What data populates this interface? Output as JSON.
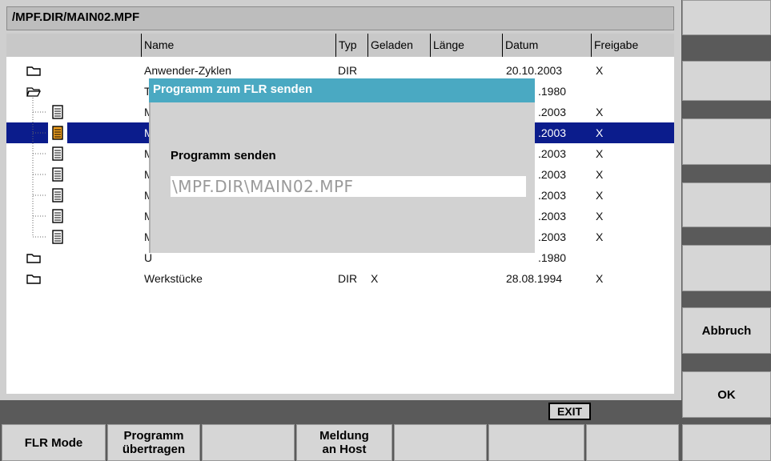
{
  "path": "/MPF.DIR/MAIN02.MPF",
  "columns": {
    "name": "Name",
    "type": "Typ",
    "loaded": "Geladen",
    "length": "Länge",
    "date": "Datum",
    "release": "Freigabe"
  },
  "rows": [
    {
      "icon": "folder-icon",
      "name": "Anwender-Zyklen",
      "type": "DIR",
      "loaded": "",
      "date": "20.10.2003",
      "release": "X"
    },
    {
      "icon": "folder-open-icon",
      "name": "T",
      "type": "",
      "loaded": "",
      "date": ".1980",
      "release": ""
    },
    {
      "icon": "file-icon",
      "name": "M",
      "type": "",
      "loaded": "",
      "date": ".2003",
      "release": "X"
    },
    {
      "icon": "file-active-icon",
      "name": "M",
      "type": "",
      "loaded": "",
      "date": ".2003",
      "release": "X"
    },
    {
      "icon": "file-icon",
      "name": "M",
      "type": "",
      "loaded": "",
      "date": ".2003",
      "release": "X"
    },
    {
      "icon": "file-icon",
      "name": "M",
      "type": "",
      "loaded": "",
      "date": ".2003",
      "release": "X"
    },
    {
      "icon": "file-icon",
      "name": "M",
      "type": "",
      "loaded": "",
      "date": ".2003",
      "release": "X"
    },
    {
      "icon": "file-icon",
      "name": "M",
      "type": "",
      "loaded": "",
      "date": ".2003",
      "release": "X"
    },
    {
      "icon": "file-icon",
      "name": "M",
      "type": "",
      "loaded": "",
      "date": ".2003",
      "release": "X"
    },
    {
      "icon": "folder-icon",
      "name": "U",
      "type": "",
      "loaded": "",
      "date": ".1980",
      "release": ""
    },
    {
      "icon": "folder-icon",
      "name": "Werkstücke",
      "type": "DIR",
      "loaded": "X",
      "date": "28.08.1994",
      "release": "X"
    }
  ],
  "dialog": {
    "title": "Programm zum FLR senden",
    "label": "Programm senden",
    "value": "\\MPF.DIR\\MAIN02.MPF"
  },
  "status": {
    "exit": "EXIT"
  },
  "right_softkeys": [
    "",
    "",
    "",
    "",
    "",
    "Abbruch",
    "OK"
  ],
  "bottom_softkeys": [
    "FLR Mode",
    "Programm übertragen",
    "",
    "Meldung an Host",
    "",
    "",
    "",
    ""
  ],
  "colors": {
    "selection": "#0b1c8c",
    "dialog_title": "#4aa9c2",
    "active_file": "#f0a020"
  }
}
